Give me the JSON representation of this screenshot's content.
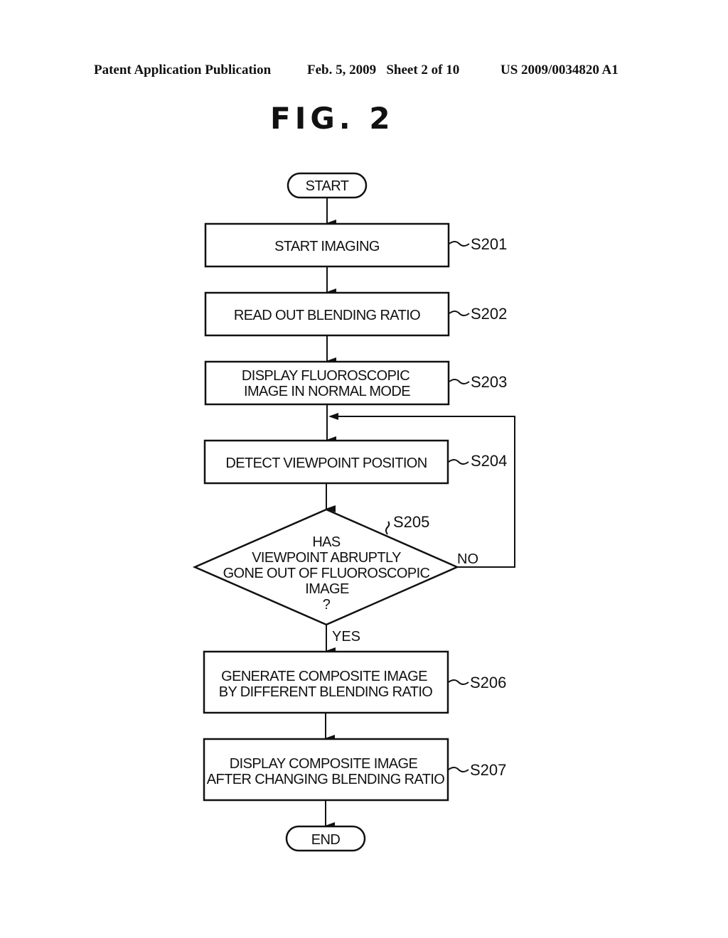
{
  "header": {
    "publication": "Patent Application Publication",
    "date_sheet": "Feb. 5, 2009   Sheet 2 of 10",
    "patent_number": "US 2009/0034820 A1"
  },
  "figure": {
    "title": "FIG. 2"
  },
  "flowchart": {
    "start": "START",
    "end": "END",
    "steps": [
      {
        "id": "S201",
        "lines": [
          "START IMAGING"
        ]
      },
      {
        "id": "S202",
        "lines": [
          "READ OUT BLENDING RATIO"
        ]
      },
      {
        "id": "S203",
        "lines": [
          "DISPLAY FLUOROSCOPIC",
          "IMAGE IN NORMAL MODE"
        ]
      },
      {
        "id": "S204",
        "lines": [
          "DETECT VIEWPOINT POSITION"
        ]
      },
      {
        "id": "S206",
        "lines": [
          "GENERATE COMPOSITE IMAGE",
          "BY DIFFERENT BLENDING RATIO"
        ]
      },
      {
        "id": "S207",
        "lines": [
          "DISPLAY COMPOSITE IMAGE",
          "AFTER CHANGING BLENDING RATIO"
        ]
      }
    ],
    "decision": {
      "id": "S205",
      "lines": [
        "HAS",
        "VIEWPOINT ABRUPTLY",
        "GONE OUT OF FLUOROSCOPIC",
        "IMAGE",
        "?"
      ],
      "yes_label": "YES",
      "no_label": "NO"
    }
  }
}
